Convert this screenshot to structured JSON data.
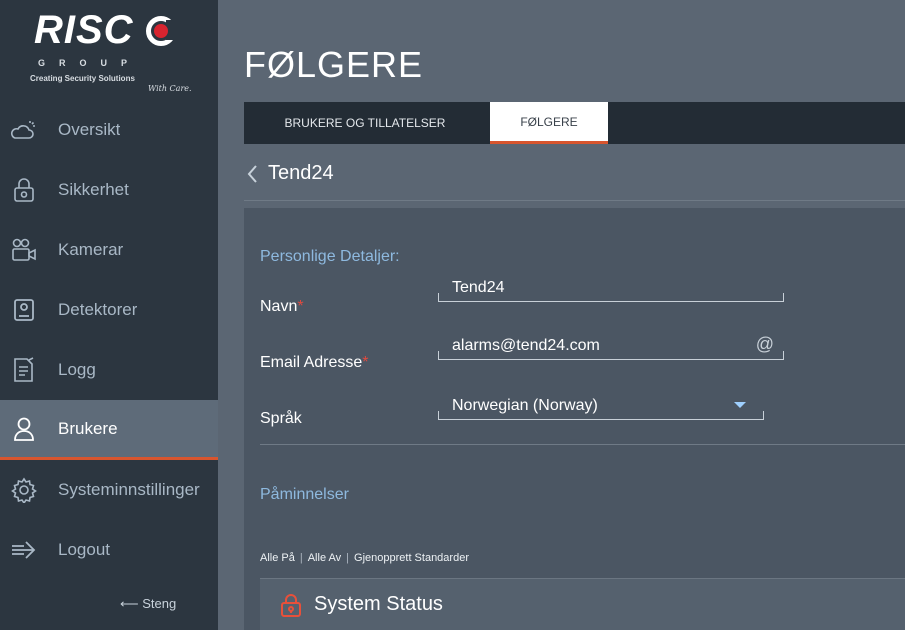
{
  "logo": {
    "brand": "RISC",
    "group": "GROUP",
    "tagline": "Creating Security Solutions",
    "signature": "With Care."
  },
  "nav": {
    "items": [
      {
        "label": "Oversikt",
        "icon": "weather-icon"
      },
      {
        "label": "Sikkerhet",
        "icon": "lock-icon"
      },
      {
        "label": "Kamerar",
        "icon": "camera-icon"
      },
      {
        "label": "Detektorer",
        "icon": "detector-icon"
      },
      {
        "label": "Logg",
        "icon": "log-icon"
      },
      {
        "label": "Brukere",
        "icon": "user-icon",
        "active": true
      },
      {
        "label": "Systeminnstillinger",
        "icon": "gear-icon"
      },
      {
        "label": "Logout",
        "icon": "logout-icon"
      }
    ],
    "close_label": "⟵ Steng"
  },
  "page": {
    "title": "FØLGERE"
  },
  "tabs": [
    {
      "label": "BRUKERE OG TILLATELSER"
    },
    {
      "label": "FØLGERE",
      "active": true
    }
  ],
  "breadcrumb": {
    "label": "Tend24"
  },
  "personal": {
    "heading": "Personlige Detaljer:",
    "name_label": "Navn",
    "name_value": "Tend24",
    "email_label": "Email Adresse",
    "email_value": "alarms@tend24.com",
    "email_suffix": "@",
    "language_label": "Språk",
    "language_value": "Norwegian (Norway)",
    "required_mark": "*"
  },
  "reminders": {
    "heading": "Påminnelser",
    "all_on": "Alle På",
    "all_off": "Alle Av",
    "restore": "Gjenopprett Standarder",
    "separator": "|"
  },
  "system_status": {
    "label": "System Status"
  },
  "colors": {
    "sidebar_bg": "#2c3640",
    "accent_orange": "#d8552e",
    "heading_blue": "#8eb9df",
    "required_red": "#e04a3f"
  }
}
